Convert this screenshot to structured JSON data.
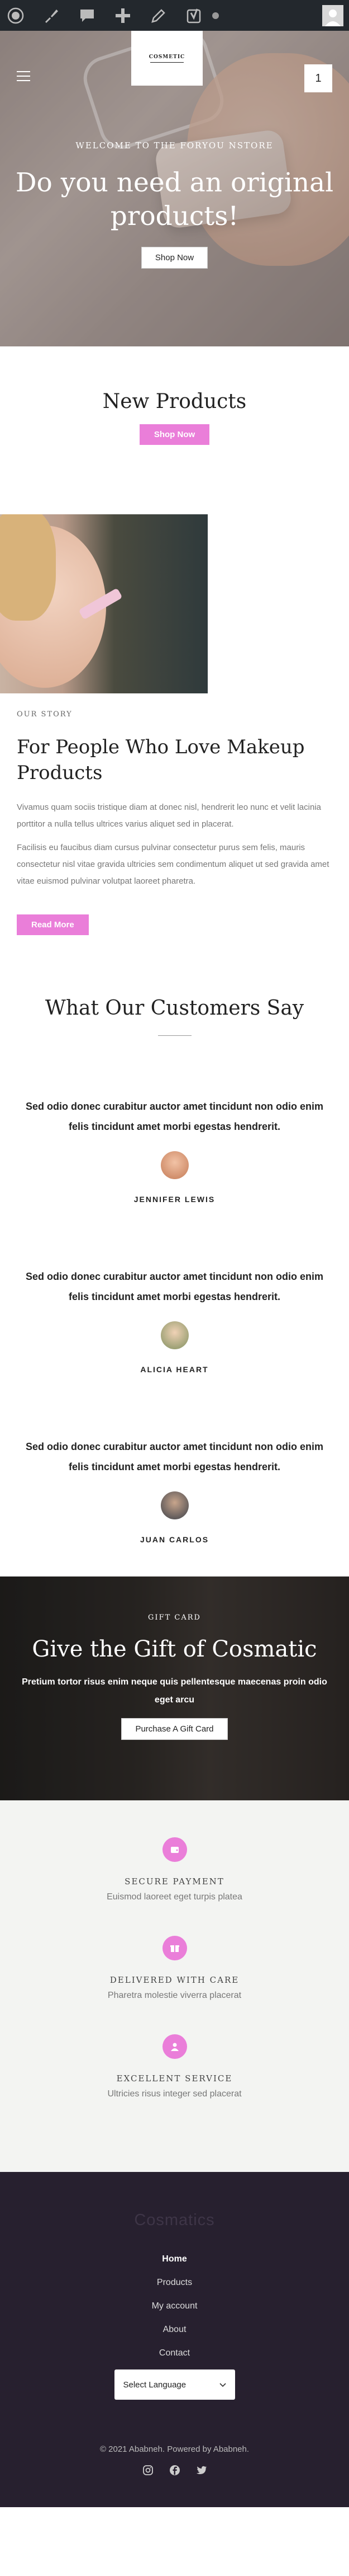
{
  "admin_bar": {
    "icons": [
      "wordpress-icon",
      "customize-icon",
      "comments-icon",
      "new-icon",
      "edit-icon",
      "yoast-icon",
      "status-dot-icon",
      "user-avatar"
    ]
  },
  "header": {
    "logo_text": "COSMETIC",
    "cart_count": "1",
    "menu_icon": "hamburger-menu-icon"
  },
  "hero": {
    "eyebrow": "WELCOME TO THE FORYOU NSTORE",
    "title": "Do you need an original products!",
    "button": "Shop Now"
  },
  "new_products": {
    "title": "New Products",
    "button": "Shop Now"
  },
  "story": {
    "eyebrow": "OUR STORY",
    "title": "For People Who Love Makeup Products",
    "paragraph1": "Vivamus quam sociis tristique diam at donec nisl, hendrerit leo nunc et velit lacinia porttitor a nulla tellus ultrices varius aliquet sed in placerat.",
    "paragraph2": "Facilisis eu faucibus diam cursus pulvinar consectetur purus sem felis, mauris consectetur nisl vitae gravida ultricies sem condimentum aliquet ut sed gravida amet vitae euismod pulvinar volutpat laoreet pharetra.",
    "button": "Read More"
  },
  "testimonials": {
    "title": "What Our Customers Say",
    "items": [
      {
        "quote": "Sed odio donec curabitur auctor amet tincidunt non odio enim felis tincidunt amet morbi egestas hendrerit.",
        "name": "JENNIFER LEWIS",
        "avatar_color": "#d98c6a"
      },
      {
        "quote": "Sed odio donec curabitur auctor amet tincidunt non odio enim felis tincidunt amet morbi egestas hendrerit.",
        "name": "ALICIA HEART",
        "avatar_color": "#8a9a6a"
      },
      {
        "quote": "Sed odio donec curabitur auctor amet tincidunt non odio enim felis tincidunt amet morbi egestas hendrerit.",
        "name": "JUAN CARLOS",
        "avatar_color": "#4a4f5a"
      }
    ]
  },
  "gift": {
    "eyebrow": "GIFT CARD",
    "title": "Give the Gift of Cosmatic",
    "text": "Pretium tortor risus enim neque quis pellentesque maecenas proin odio eget arcu",
    "button": "Purchase A Gift Card"
  },
  "features": [
    {
      "icon": "wallet-icon",
      "title": "SECURE PAYMENT",
      "text": "Euismod laoreet eget turpis platea"
    },
    {
      "icon": "gift-icon",
      "title": "DELIVERED WITH CARE",
      "text": "Pharetra molestie viverra placerat"
    },
    {
      "icon": "support-icon",
      "title": "EXCELLENT SERVICE",
      "text": "Ultricies risus integer sed placerat"
    }
  ],
  "footer": {
    "logo": "Cosmatics",
    "menu": [
      "Home",
      "Products",
      "My account",
      "About",
      "Contact"
    ],
    "language_select": "Select Language",
    "copyright": "© 2021 Ababneh. Powered by Ababneh.",
    "social": [
      "instagram-icon",
      "facebook-icon",
      "twitter-icon"
    ]
  },
  "colors": {
    "accent_pink": "#ea7ed9",
    "admin_bar": "#23282d",
    "footer_bg": "#27202f",
    "features_bg": "#f3f4f2"
  }
}
